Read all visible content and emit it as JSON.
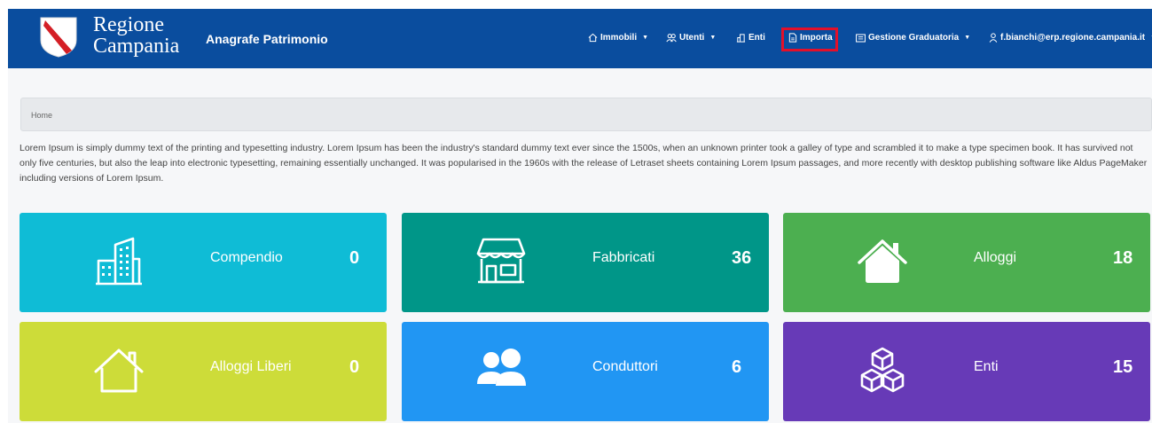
{
  "header": {
    "logo_line1": "Regione",
    "logo_line2": "Campania",
    "app_title": "Anagrafe Patrimonio",
    "nav": {
      "immobili": "Immobili",
      "utenti": "Utenti",
      "enti": "Enti",
      "importa": "Importa",
      "graduatoria": "Gestione Graduatoria",
      "user": "f.bianchi@erp.regione.campania.it"
    },
    "caret": "▼"
  },
  "breadcrumb": {
    "home": "Home"
  },
  "intro_text": "Lorem Ipsum is simply dummy text of the printing and typesetting industry. Lorem Ipsum has been the industry's standard dummy text ever since the 1500s, when an unknown printer took a galley of type and scrambled it to make a type specimen book. It has survived not only five centuries, but also the leap into electronic typesetting, remaining essentially unchanged. It was popularised in the 1960s with the release of Letraset sheets containing Lorem Ipsum passages, and more recently with desktop publishing software like Aldus PageMaker including versions of Lorem Ipsum.",
  "cards": [
    {
      "label": "Compendio",
      "count": "0",
      "color": "#0fbcd6",
      "icon": "building-icon"
    },
    {
      "label": "Fabbricati",
      "count": "36",
      "color": "#009688",
      "icon": "storefront-icon"
    },
    {
      "label": "Alloggi",
      "count": "18",
      "color": "#4caf50",
      "icon": "house-filled-icon"
    },
    {
      "label": "Alloggi Liberi",
      "count": "0",
      "color": "#cddc39",
      "icon": "house-outline-icon"
    },
    {
      "label": "Conduttori",
      "count": "6",
      "color": "#2196f3",
      "icon": "users-icon"
    },
    {
      "label": "Enti",
      "count": "15",
      "color": "#673ab7",
      "icon": "cubes-icon"
    }
  ],
  "colors": {
    "navbar": "#0a4d9e",
    "highlight": "#e3102a"
  }
}
